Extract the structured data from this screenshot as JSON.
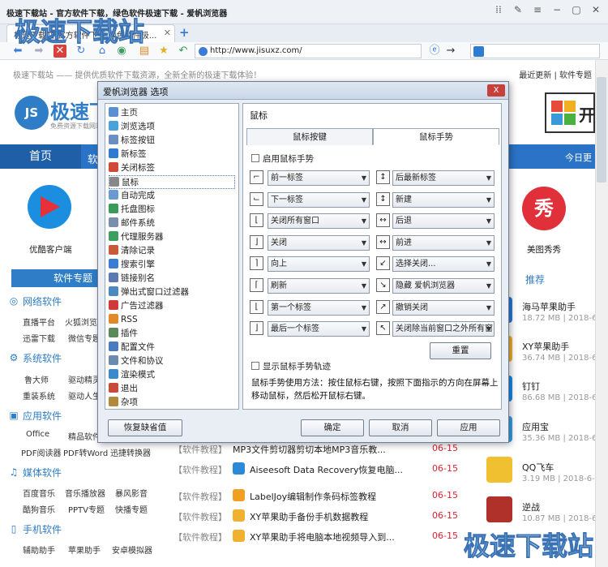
{
  "browser": {
    "window_title": "极速下载站 - 官方软件下载，绿色软件极速下载 - 爱帆浏览器",
    "tab_title": "极速下载站-官方软件下载,绿色软件极...",
    "address": "http://www.jisuxz.com/"
  },
  "page": {
    "slogan": "极速下载站 —— 提供优质软件下载资源，全新全新的极速下载体验！",
    "top_links": "最近更新 | 软件专题",
    "logo_mark": "JS",
    "logo_name": "极速下",
    "logo_sub": "免费资源下载网站",
    "nav_home": "首页",
    "nav_soft": "软",
    "nav_today": "今日更",
    "apps": [
      {
        "name": "优酷客户端"
      },
      {
        "name": "美图秀秀"
      }
    ],
    "right_logo": "开",
    "section_bar": "软件专题",
    "recommend_title": "推荐",
    "categories": [
      {
        "title": "网络软件",
        "links": [
          "直播平台",
          "火狐浏览",
          "迅雷下载",
          "微信专题"
        ]
      },
      {
        "title": "系统软件",
        "links": [
          "鲁大师",
          "驱动精灵",
          "重装系统",
          "驱动人生"
        ]
      },
      {
        "title": "应用软件",
        "links": [
          "Office",
          "精品软件",
          "PDF阅读器",
          "PDF转Word",
          "迅捷转换器"
        ]
      },
      {
        "title": "媒体软件",
        "links": [
          "百度音乐",
          "音乐播放器",
          "暴风影音",
          "酷狗音乐",
          "PPTV专题",
          "快播专题"
        ]
      },
      {
        "title": "手机软件",
        "links": [
          "辅助助手",
          "苹果助手",
          "安卓模拟器"
        ]
      }
    ],
    "articles": [
      {
        "tag": "【软件教程】",
        "title": "MP3文件剪切器剪切本地MP3音乐教...",
        "date": "06-15"
      },
      {
        "tag": "【软件教程】",
        "title": "Aiseesoft Data Recovery恢复电脑...",
        "date": "06-15"
      },
      {
        "tag": "【软件教程】",
        "title": "LabelJoy编辑制作条码标签教程",
        "date": "06-15"
      },
      {
        "tag": "【软件教程】",
        "title": "XY苹果助手备份手机数据教程",
        "date": "06-15"
      },
      {
        "tag": "【软件教程】",
        "title": "XY苹果助手将电脑本地视频导入到...",
        "date": "06-15"
      }
    ],
    "side_list": [
      {
        "name": "海马苹果助手",
        "meta": "18.72 MB | 2018-6-"
      },
      {
        "name": "XY苹果助手",
        "meta": "36.74 MB | 2018-6-"
      },
      {
        "name": "钉钉",
        "meta": "86.68 MB | 2018-6-"
      },
      {
        "name": "应用宝",
        "meta": "35.36 MB | 2018-6-"
      },
      {
        "name": "QQ飞车",
        "meta": "3.19 MB | 2018-6-"
      },
      {
        "name": "逆战",
        "meta": "10.87 MB | 2018-6-"
      }
    ],
    "watermark": "极速下载站"
  },
  "dialog": {
    "title": "爱帆浏览器 选项",
    "close_label": "X",
    "tree": [
      {
        "label": "主页",
        "color": "#5a8fd0"
      },
      {
        "label": "浏览选项",
        "color": "#4aa3d8"
      },
      {
        "label": "标签按钮",
        "color": "#6b8fc2"
      },
      {
        "label": "新标签",
        "color": "#2e7bd6"
      },
      {
        "label": "关闭标签",
        "color": "#d04a3a"
      },
      {
        "label": "鼠标",
        "color": "#888888"
      },
      {
        "label": "自动完成",
        "color": "#6a9ad0"
      },
      {
        "label": "托盘图标",
        "color": "#3a9a5a"
      },
      {
        "label": "邮件系统",
        "color": "#7a8fb0"
      },
      {
        "label": "代理服务器",
        "color": "#3aa060"
      },
      {
        "label": "清除记录",
        "color": "#c85a3a"
      },
      {
        "label": "搜索引擎",
        "color": "#3a7bd5"
      },
      {
        "label": "链接别名",
        "color": "#5a7ab0"
      },
      {
        "label": "弹出式窗口过滤器",
        "color": "#4a8ac0"
      },
      {
        "label": "广告过滤器",
        "color": "#d03a3a"
      },
      {
        "label": "RSS",
        "color": "#e08a2a"
      },
      {
        "label": "插件",
        "color": "#5a8a5a"
      },
      {
        "label": "配置文件",
        "color": "#4a7ac0"
      },
      {
        "label": "文件和协议",
        "color": "#6a8ab0"
      },
      {
        "label": "渲染模式",
        "color": "#3a8ad0"
      },
      {
        "label": "退出",
        "color": "#c84a3a"
      },
      {
        "label": "杂项",
        "color": "#b08a3a"
      }
    ],
    "selected_index": 5,
    "panel_title": "鼠标",
    "tabs": [
      "鼠标按键",
      "鼠标手势"
    ],
    "enable_gesture": "启用鼠标手势",
    "gestures_left": [
      {
        "glyph": "⌐",
        "value": "前一标签"
      },
      {
        "glyph": "⌙",
        "value": "下一标签"
      },
      {
        "glyph": "⌊",
        "value": "关闭所有窗口"
      },
      {
        "glyph": "⌋",
        "value": "关闭"
      },
      {
        "glyph": "⌉",
        "value": "向上"
      },
      {
        "glyph": "⌈",
        "value": "刷新"
      },
      {
        "glyph": "⌊",
        "value": "第一个标签"
      },
      {
        "glyph": "⌋",
        "value": "最后一个标签"
      }
    ],
    "gestures_right": [
      {
        "glyph": "↕",
        "value": "后最新标签"
      },
      {
        "glyph": "↕",
        "value": "新建"
      },
      {
        "glyph": "↔",
        "value": "后退"
      },
      {
        "glyph": "↔",
        "value": "前进"
      },
      {
        "glyph": "↙",
        "value": "选择关闭..."
      },
      {
        "glyph": "↘",
        "value": "隐藏 爱帆浏览器"
      },
      {
        "glyph": "↗",
        "value": "撤销关闭"
      },
      {
        "glyph": "↖",
        "value": "关闭除当前窗口之外所有窗"
      }
    ],
    "reset_label": "重置",
    "show_trail": "显示鼠标手势轨迹",
    "help_text": "鼠标手势使用方法：按住鼠标右键，按照下面指示的方向在屏幕上移动鼠标，然后松开鼠标右键。",
    "restore_defaults": "恢复缺省值",
    "ok": "确定",
    "cancel": "取消",
    "apply": "应用"
  }
}
